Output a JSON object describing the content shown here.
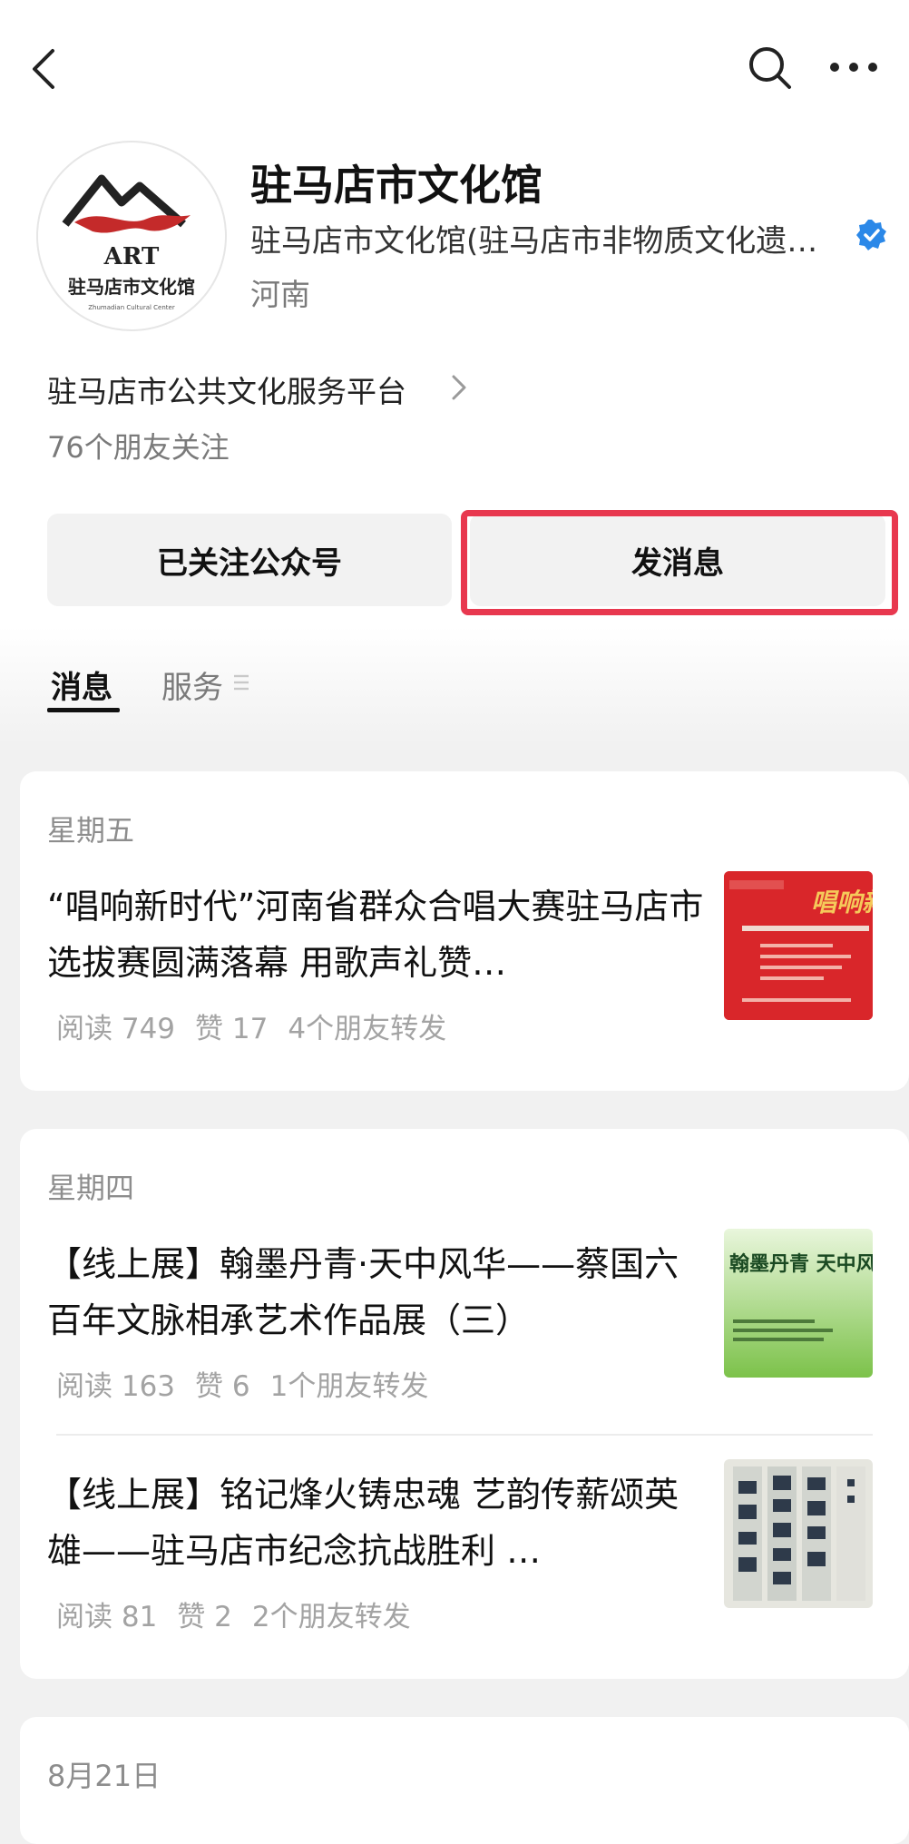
{
  "account": {
    "name": "驻马店市文化馆",
    "subtitle": "驻马店市文化馆(驻马店市非物质文化遗…",
    "region": "河南",
    "logo_text_top": "ART",
    "logo_text_main": "驻马店市文化馆",
    "logo_text_en": "Zhumadian Cultural Center"
  },
  "service_link": "驻马店市公共文化服务平台",
  "friends_following": "76个朋友关注",
  "buttons": {
    "followed": "已关注公众号",
    "send_message": "发消息"
  },
  "tabs": [
    {
      "label": "消息",
      "active": true
    },
    {
      "label": "服务",
      "active": false
    }
  ],
  "groups": [
    {
      "day": "星期五",
      "articles": [
        {
          "title": "“唱响新时代”河南省群众合唱大赛驻马店市选拔赛圆满落幕 用歌声礼赞…",
          "reads": "阅读 749",
          "likes": "赞 17",
          "shares": "4个朋友转发",
          "thumb_color": "#d9262a",
          "thumb_text": "唱响新"
        }
      ]
    },
    {
      "day": "星期四",
      "articles": [
        {
          "title": "【线上展】翰墨丹青·天中风华——蔡国六百年文脉相承艺术作品展（三）",
          "reads": "阅读 163",
          "likes": "赞 6",
          "shares": "1个朋友转发",
          "thumb_color": "#8fcf5c",
          "thumb_text": "翰墨丹青 天中风华"
        },
        {
          "title": "【线上展】铭记烽火铸忠魂  艺韵传薪颂英雄——驻马店市纪念抗战胜利 …",
          "reads": "阅读 81",
          "likes": "赞 2",
          "shares": "2个朋友转发",
          "thumb_color": "#d8d8d2",
          "thumb_text": ""
        }
      ]
    },
    {
      "day": "8月21日",
      "articles": []
    }
  ],
  "colors": {
    "highlight": "#e8384f",
    "verified": "#2b88e8"
  }
}
